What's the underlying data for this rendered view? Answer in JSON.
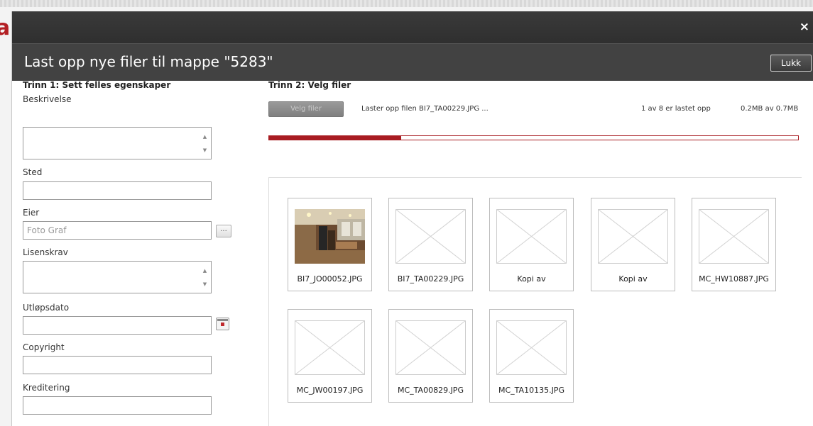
{
  "background": {
    "partial_letter": "a"
  },
  "dialog": {
    "close_icon": "×",
    "title": "Last opp nye filer til mappe \"5283\"",
    "close_button": "Lukk"
  },
  "step1": {
    "title": "Trinn 1: Sett felles egenskaper",
    "fields": {
      "description": {
        "label": "Beskrivelse",
        "value": ""
      },
      "place": {
        "label": "Sted",
        "value": ""
      },
      "owner": {
        "label": "Eier",
        "value": "Foto Graf",
        "browse_button": "..."
      },
      "license": {
        "label": "Lisenskrav",
        "value": ""
      },
      "expiry": {
        "label": "Utløpsdato",
        "value": ""
      },
      "copyright": {
        "label": "Copyright",
        "value": ""
      },
      "credit": {
        "label": "Kreditering",
        "value": ""
      }
    }
  },
  "step2": {
    "title": "Trinn 2: Velg filer",
    "select_button": "Velg filer",
    "status": "Laster opp filen BI7_TA00229.JPG ...",
    "count": "1 av 8 er lastet opp",
    "size": "0.2MB av 0.7MB",
    "progress_fraction": 0.25
  },
  "files": [
    {
      "name": "BI7_JO00052.JPG",
      "has_preview": true
    },
    {
      "name": "BI7_TA00229.JPG",
      "has_preview": false
    },
    {
      "name": "Kopi av",
      "has_preview": false
    },
    {
      "name": "Kopi av",
      "has_preview": false
    },
    {
      "name": "MC_HW10887.JPG",
      "has_preview": false
    },
    {
      "name": "MC_JW00197.JPG",
      "has_preview": false
    },
    {
      "name": "MC_TA00829.JPG",
      "has_preview": false
    },
    {
      "name": "MC_TA10135.JPG",
      "has_preview": false
    }
  ],
  "colors": {
    "accent": "#a81c22",
    "header": "#424242",
    "titlebar": "#333333"
  }
}
